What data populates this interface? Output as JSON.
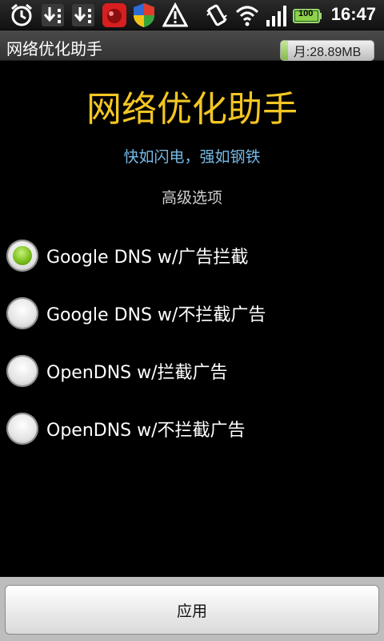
{
  "status_bar": {
    "time": "16:47",
    "battery_level": "100",
    "icons": [
      "alarm-icon",
      "download-icon",
      "download-icon",
      "app-notification-icon",
      "shield-icon",
      "warning-icon",
      "vibrate-icon",
      "wifi-icon",
      "signal-icon",
      "battery-icon"
    ]
  },
  "title_bar": {
    "title": "网络优化助手",
    "traffic": "月:28.89MB",
    "traffic_fill": 0.08
  },
  "main": {
    "heading": "网络优化助手",
    "subtitle": "快如闪电，强如钢铁",
    "section_label": "高级选项",
    "options": [
      {
        "label": "Google DNS w/广告拦截",
        "checked": true
      },
      {
        "label": "Google DNS w/不拦截广告",
        "checked": false
      },
      {
        "label": "OpenDNS w/拦截广告",
        "checked": false
      },
      {
        "label": "OpenDNS w/不拦截广告",
        "checked": false
      }
    ]
  },
  "footer": {
    "apply_label": "应用"
  },
  "colors": {
    "heading": "#f3c623",
    "subtitle": "#76b9e6",
    "radio_checked": "#7cc01d"
  }
}
